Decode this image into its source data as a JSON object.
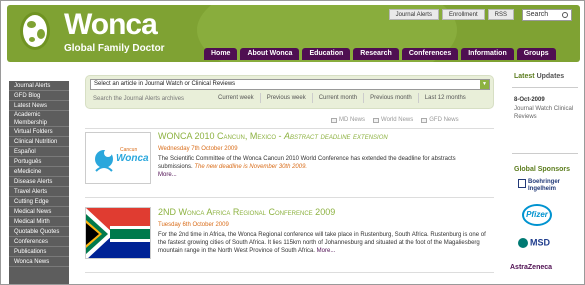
{
  "header": {
    "logo_name": "Wonca",
    "logo_sub": "Global Family Doctor",
    "top_links": [
      "Journal Alerts",
      "Enrollment",
      "RSS"
    ],
    "search_value": "Search",
    "nav": [
      "Home",
      "About Wonca",
      "Education",
      "Research",
      "Conferences",
      "Information",
      "Groups"
    ]
  },
  "sidebar": {
    "items": [
      "Journal Alerts",
      "GFD Blog",
      "Latest News",
      "Academic Membership",
      "Virtual Folders",
      "Clinical Nutrition",
      "Español",
      "Português",
      "eMedicine",
      "Disease Alerts",
      "Travel Alerts",
      "Cutting Edge",
      "Medical News",
      "Medical Mirth",
      "Quotable Quotes",
      "Conferences",
      "Publications",
      "Wonca News"
    ]
  },
  "main": {
    "select_placeholder": "Select an article in Journal Watch or Clinical Reviews",
    "search_label": "Search the Journal Alerts archives",
    "periods": [
      "Current week",
      "Previous week",
      "Current month",
      "Previous month",
      "Last 12 months"
    ],
    "filters": [
      "MD News",
      "World News",
      "GFD News"
    ],
    "articles": [
      {
        "thumb_text": "Wonca",
        "thumb_sub": "Cancun",
        "title_plain": "WONCA 2010 Cancun, Mexico - ",
        "title_em": "Abstract deadline extension",
        "date": "Wednesday 7th October 2009",
        "body": "The Scientific Committee of the Wonca Cancun 2010 World Conference has extended the deadline for abstracts submissions.",
        "body_red": "The new deadline is November 30th 2009.",
        "more": "More..."
      },
      {
        "title_plain": "2ND Wonca Africa Regional Conference 2009",
        "date": "Tuesday 6th October 2009",
        "body": "For the 2nd time in Africa, the Wonca Regional conference will take place in Rustenburg, South Africa. Rustenburg is one of the fastest growing cities of South Africa. It lies 115km north of Johannesburg and situated at the foot of the Magaliesberg mountain range in the North West Province of South Africa.",
        "more": "More..."
      }
    ]
  },
  "right": {
    "updates_head_1": "Latest",
    "updates_head_2": "Updates",
    "update_date": "8-Oct-2009",
    "update_text": "Journal Watch Clinical Reviews",
    "sponsors_head": "Global Sponsors",
    "sponsors": [
      "Boehringer Ingelheim",
      "Pfizer",
      "MSD",
      "AstraZeneca"
    ]
  },
  "colors": {
    "brand_green": "#7fa233",
    "nav_purple": "#4f0f52",
    "accent_orange": "#d96d1a"
  }
}
